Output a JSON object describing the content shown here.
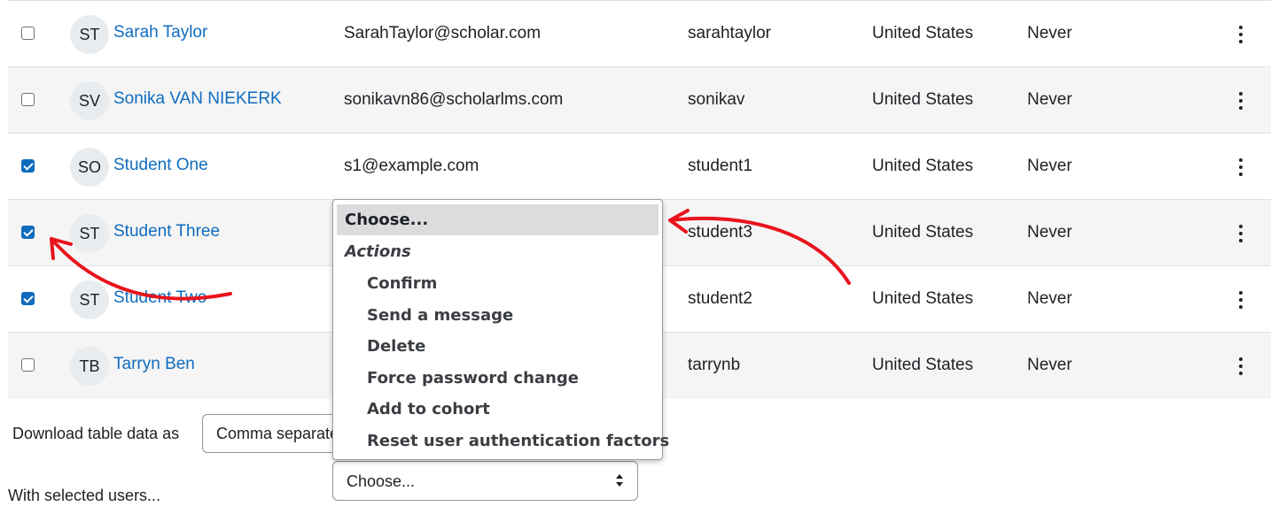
{
  "rows": [
    {
      "checked": false,
      "initials": "ST",
      "name": "Sarah Taylor",
      "email": "SarahTaylor@scholar.com",
      "username": "sarahtaylor",
      "country": "United States",
      "last_access": "Never"
    },
    {
      "checked": false,
      "initials": "SV",
      "name": "Sonika VAN NIEKERK",
      "email": "sonikavn86@scholarlms.com",
      "username": "sonikav",
      "country": "United States",
      "last_access": "Never"
    },
    {
      "checked": true,
      "initials": "SO",
      "name": "Student One",
      "email": "s1@example.com",
      "username": "student1",
      "country": "United States",
      "last_access": "Never"
    },
    {
      "checked": true,
      "initials": "ST",
      "name": "Student Three",
      "email": "",
      "username": "student3",
      "country": "United States",
      "last_access": "Never"
    },
    {
      "checked": true,
      "initials": "ST",
      "name": "Student Two",
      "email": "",
      "username": "student2",
      "country": "United States",
      "last_access": "Never"
    },
    {
      "checked": false,
      "initials": "TB",
      "name": "Tarryn Ben",
      "email": "",
      "username": "tarrynb",
      "country": "United States",
      "last_access": "Never"
    }
  ],
  "download": {
    "label": "Download table data as",
    "format_value": "Comma separated values (.csv)"
  },
  "bulk": {
    "label": "With selected users...",
    "select_value": "Choose..."
  },
  "dropdown": {
    "highlighted": "Choose...",
    "group_label": "Actions",
    "items": [
      "Confirm",
      "Send a message",
      "Delete",
      "Force password change",
      "Add to cohort",
      "Reset user authentication factors"
    ]
  },
  "colors": {
    "accent": "#0f6cbf",
    "annotation": "#e8141c",
    "row_alt": "#f5f5f5"
  },
  "icons": {
    "row_menu": "kebab-menu-icon",
    "select_caret": "sort-caret-icon"
  }
}
